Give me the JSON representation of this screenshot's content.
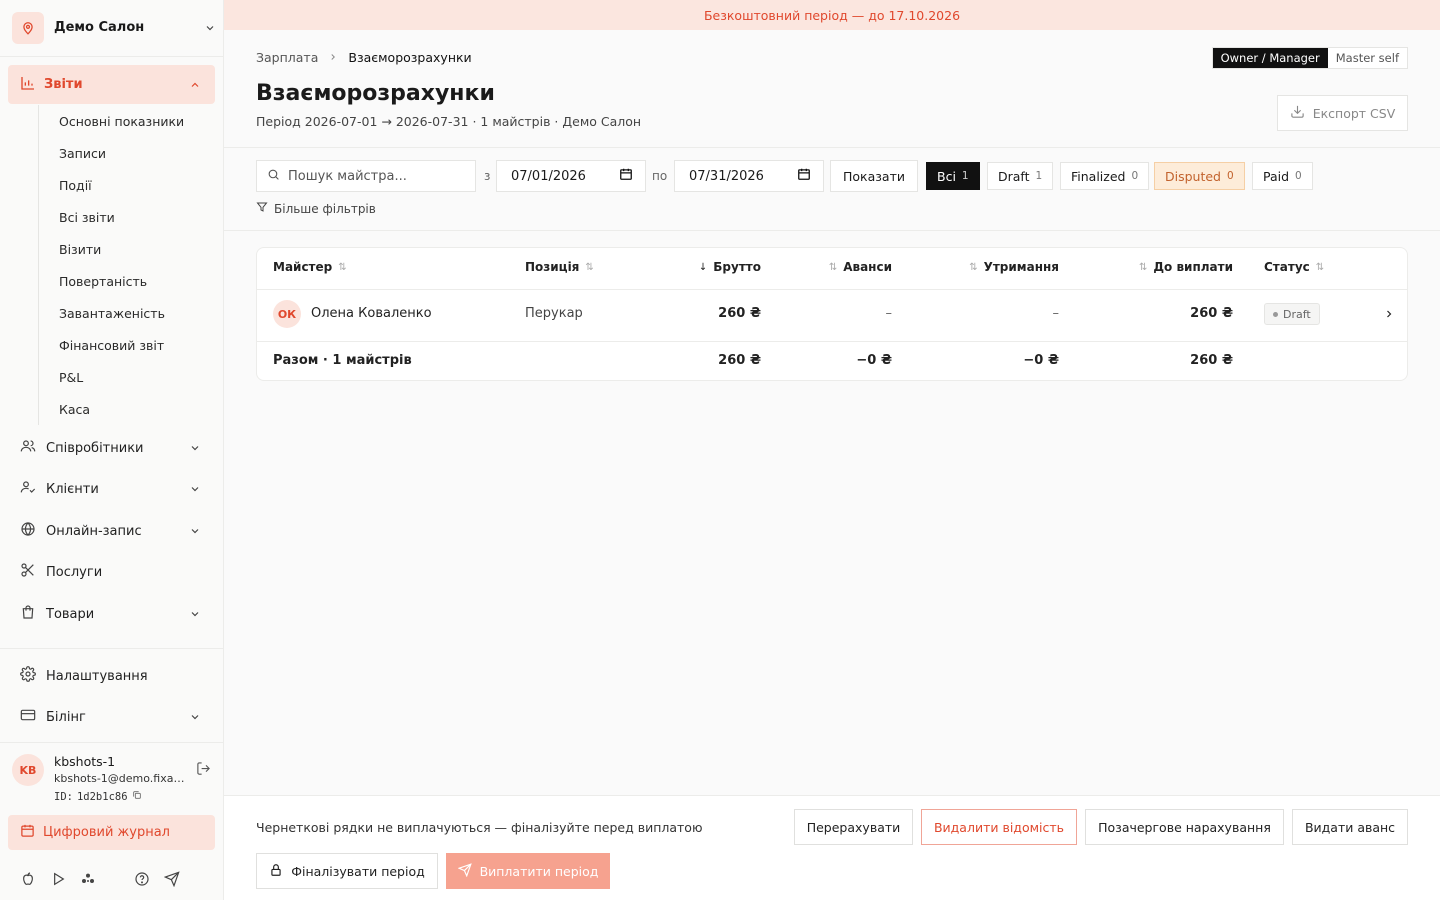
{
  "sidebar": {
    "salon_name": "Демо Салон",
    "reports": {
      "label": "Звіти",
      "items": [
        "Основні показники",
        "Записи",
        "Події",
        "Всі звіти",
        "Візити",
        "Повертаність",
        "Завантаженість",
        "Фінансовий звіт",
        "P&L",
        "Каса"
      ]
    },
    "nav": [
      {
        "label": "Співробітники",
        "icon": "users-icon",
        "expandable": true
      },
      {
        "label": "Клієнти",
        "icon": "user-check-icon",
        "expandable": true
      },
      {
        "label": "Онлайн-запис",
        "icon": "globe-icon",
        "expandable": true
      },
      {
        "label": "Послуги",
        "icon": "scissors-icon",
        "expandable": false
      },
      {
        "label": "Товари",
        "icon": "shopping-bag-icon",
        "expandable": true
      }
    ],
    "settings_label": "Налаштування",
    "billing_label": "Білінг",
    "user": {
      "initials": "KB",
      "name": "kbshots-1",
      "email": "kbshots-1@demo.fixa.b...",
      "id_label": "ID:",
      "id": "1d2b1c86"
    },
    "journal_label": "Цифровий журнал"
  },
  "trial_banner": "Безкоштовний період — до 17.10.2026",
  "breadcrumb": {
    "parent": "Зарплата",
    "current": "Взаєморозрахунки"
  },
  "roles": [
    {
      "label": "Owner / Manager",
      "active": true
    },
    {
      "label": "Master self",
      "active": false
    }
  ],
  "page": {
    "title": "Взаєморозрахунки",
    "subtitle": "Період 2026-07-01 → 2026-07-31 · 1 майстрів · Демо Салон",
    "export_label": "Експорт CSV"
  },
  "filters": {
    "search_placeholder": "Пошук майстра...",
    "from_label": "з",
    "from_date": "07/01/2026",
    "to_label": "по",
    "to_date": "07/31/2026",
    "show_label": "Показати",
    "more_label": "Більше фільтрів",
    "chips": [
      {
        "label": "Всі",
        "count": "1"
      },
      {
        "label": "Draft",
        "count": "1"
      },
      {
        "label": "Finalized",
        "count": "0"
      },
      {
        "label": "Disputed",
        "count": "0"
      },
      {
        "label": "Paid",
        "count": "0"
      }
    ]
  },
  "table": {
    "headers": {
      "master": "Майстер",
      "position": "Позиція",
      "gross": "Брутто",
      "advances": "Аванси",
      "deductions": "Утримання",
      "payout": "До виплати",
      "status": "Статус"
    },
    "rows": [
      {
        "initials": "ОК",
        "name": "Олена Коваленко",
        "position": "Перукар",
        "gross": "260 ₴",
        "advances": "–",
        "deductions": "–",
        "payout": "260 ₴",
        "status": "Draft"
      }
    ],
    "total": {
      "label": "Разом · 1 майстрів",
      "gross": "260 ₴",
      "advances": "−0 ₴",
      "deductions": "−0 ₴",
      "payout": "260 ₴"
    }
  },
  "actions": {
    "note": "Чернеткові рядки не виплачуються — фіналізуйте перед виплатою",
    "recalc": "Перерахувати",
    "delete": "Видалити відомість",
    "offcycle": "Позачергове нарахування",
    "advance": "Видати аванс",
    "finalize": "Фіналізувати період",
    "pay": "Виплатити період"
  },
  "colors": {
    "accent": "#e0482d",
    "accent_bg": "#fbe3dc",
    "disputed_bg": "#fdecd9"
  }
}
